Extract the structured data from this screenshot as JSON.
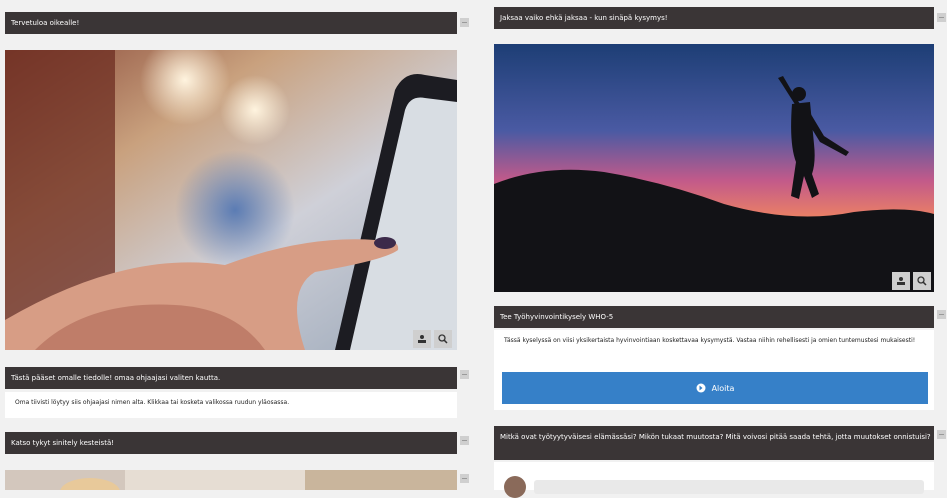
{
  "left": {
    "card1": {
      "title": "Tervetuloa oikealle!"
    },
    "card2": {
      "title": "Tästä pääset omalle tiedolle! omaa ohjaajasi valiten kautta.",
      "text": "Oma tiivisti löytyy siis ohjaajasi nimen alta. Klikkaa tai kosketa valikossa ruudun yläosassa."
    },
    "card3": {
      "title": "Katso tykyt sinitely kesteistä!"
    }
  },
  "right": {
    "card1": {
      "title": "Jaksaa vaiko ehkä jaksaa - kun sinäpä kysymys!"
    },
    "card2": {
      "title": "Tee Työhyvinvointikysely WHO-5",
      "text": "Tässä kyselyssä on viisi yksikertaista hyvinvointiaan koskettavaa kysymystä. Vastaa niihin rehellisesti ja omien tuntemustesi mukaisesti!",
      "button": "Aloita"
    },
    "card3": {
      "title": "Mitkä ovat työtyytyväisesi elämässäsi? Mikön tukaat muutosta? Mitä voivosi pitää saada tehtä, jotta muutokset onnistuisi?"
    }
  }
}
